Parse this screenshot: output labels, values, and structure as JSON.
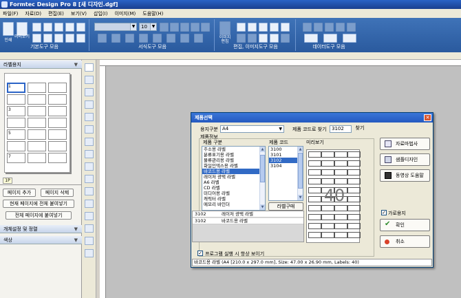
{
  "window": {
    "title": "Formtec Design Pro 8 [새 디자인.dgf]"
  },
  "menu": [
    "파일(F)",
    "자료(D)",
    "편집(E)",
    "보기(V)",
    "삽입(I)",
    "이미지(M)",
    "도움말(H)"
  ],
  "toolbar": {
    "print_label": "인쇄",
    "print_preview_label": "미리보기",
    "basic_group_label": "기본도구 모음",
    "font_size": "10",
    "format_group_label": "서식도구 모음",
    "image_edit_label": "이미지\n편집",
    "edit_group_label": "편집, 이미지도구 모음",
    "data_group_label": "데이터도구 모음"
  },
  "left_panel": {
    "header": "라벨용지",
    "cell_numbers": [
      "1",
      "3",
      "5",
      "7"
    ],
    "page_tab": "1P",
    "add_page": "페이지 추가",
    "delete_page": "페이지 삭제",
    "paste_all_current": "현재 페이지에 전체 붙여넣기",
    "paste_all_pages": "전체 페이지에 붙여넣기",
    "object_settings": "개체설정 및 정렬",
    "color": "색상"
  },
  "dialog": {
    "title": "제품선택",
    "paper_type_label": "용지구분",
    "paper_type_value": "A4",
    "product_code_search_label": "제품 코드로 찾기",
    "product_code_search_value": "3102",
    "find_button": "찾기",
    "product_info_label": "제품정보",
    "category_label": "제품 구분",
    "code_label": "제품 코드",
    "preview_label": "미리보기",
    "categories": [
      "주소용 라벨",
      "분류표기용 라벨",
      "물류관리용 라벨",
      "화일인덱스용 라벨",
      "바코드용 라벨",
      "레이저 광택 라벨",
      "A6 라벨",
      "CD 라벨",
      "미디어용 라벨",
      "캐릭터 라벨",
      "메모리 바인더"
    ],
    "selected_category": "바코드용 라벨",
    "codes": [
      "3100",
      "3101",
      "3102",
      "3104"
    ],
    "selected_code": "3102",
    "label_purchase_button": "라벨구매",
    "results": [
      {
        "code": "3102",
        "name": "레이저 광택 라벨"
      },
      {
        "code": "3102",
        "name": "바코드용 라벨"
      }
    ],
    "preview_number": "40",
    "data_wizard_button": "자료마법사",
    "sample_design_button": "샘플디자인",
    "video_help_button": "동영상 도움말",
    "landscape_label": "가로용지",
    "ok_button": "확인",
    "cancel_button": "취소",
    "show_at_startup_label": "프로그램 실행 시 항상 보이기",
    "status": "바코드용 라벨 (A4 [210.0 x 297.0 mm], Size: 47.00 x 26.90 mm, Labels: 40)"
  },
  "colors": {
    "titlebar": "#1a3f8f",
    "toolbar": "#3f73b8",
    "selection": "#316ac5",
    "canvas": "#c0c0c0"
  }
}
